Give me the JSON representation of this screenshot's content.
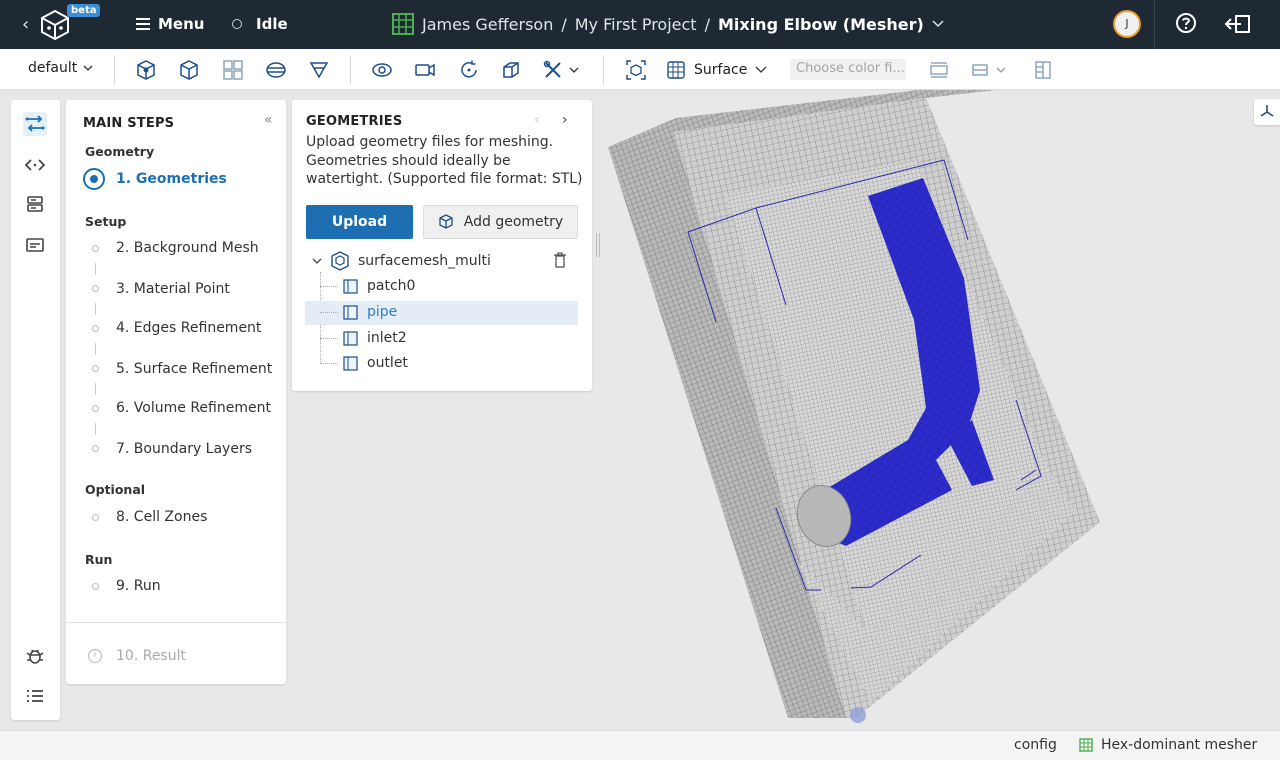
{
  "app": {
    "beta_label": "beta",
    "menu_label": "Menu",
    "status_label": "Idle",
    "breadcrumb": {
      "user": "James Gefferson",
      "separator": "/",
      "project": "My First Project",
      "job": "Mixing Elbow (Mesher)"
    },
    "avatar_initial": "J"
  },
  "toolbar": {
    "preset": "default",
    "render_mode": "Surface",
    "color_placeholder": "Choose color fi..."
  },
  "steps": {
    "title": "MAIN STEPS",
    "groups": {
      "geometry": "Geometry",
      "setup": "Setup",
      "optional": "Optional",
      "run": "Run"
    },
    "items": [
      {
        "label": "1. Geometries",
        "state": "active"
      },
      {
        "label": "2. Background Mesh",
        "state": "pending"
      },
      {
        "label": "3. Material Point",
        "state": "pending"
      },
      {
        "label": "4. Edges Refinement",
        "state": "pending"
      },
      {
        "label": "5. Surface Refinement",
        "state": "pending"
      },
      {
        "label": "6. Volume Refinement",
        "state": "pending"
      },
      {
        "label": "7. Boundary Layers",
        "state": "pending"
      },
      {
        "label": "8. Cell Zones",
        "state": "pending"
      },
      {
        "label": "9. Run",
        "state": "pending"
      },
      {
        "label": "10. Result",
        "state": "disabled"
      }
    ]
  },
  "geometries": {
    "title": "GEOMETRIES",
    "description": "Upload geometry files for meshing. Geometries should ideally be watertight. (Supported file format: STL)",
    "upload_label": "Upload",
    "add_label": "Add geometry",
    "root": "surfacemesh_multi",
    "patches": [
      {
        "label": "patch0",
        "selected": false
      },
      {
        "label": "pipe",
        "selected": true
      },
      {
        "label": "inlet2",
        "selected": false
      },
      {
        "label": "outlet",
        "selected": false
      }
    ]
  },
  "statusbar": {
    "config_label": "config",
    "mesher_label": "Hex-dominant mesher"
  },
  "colors": {
    "topbar": "#1e2933",
    "accent": "#1d6fb1",
    "pipe": "#2c2ccc",
    "mesh_grey": "#c8c8c8"
  }
}
